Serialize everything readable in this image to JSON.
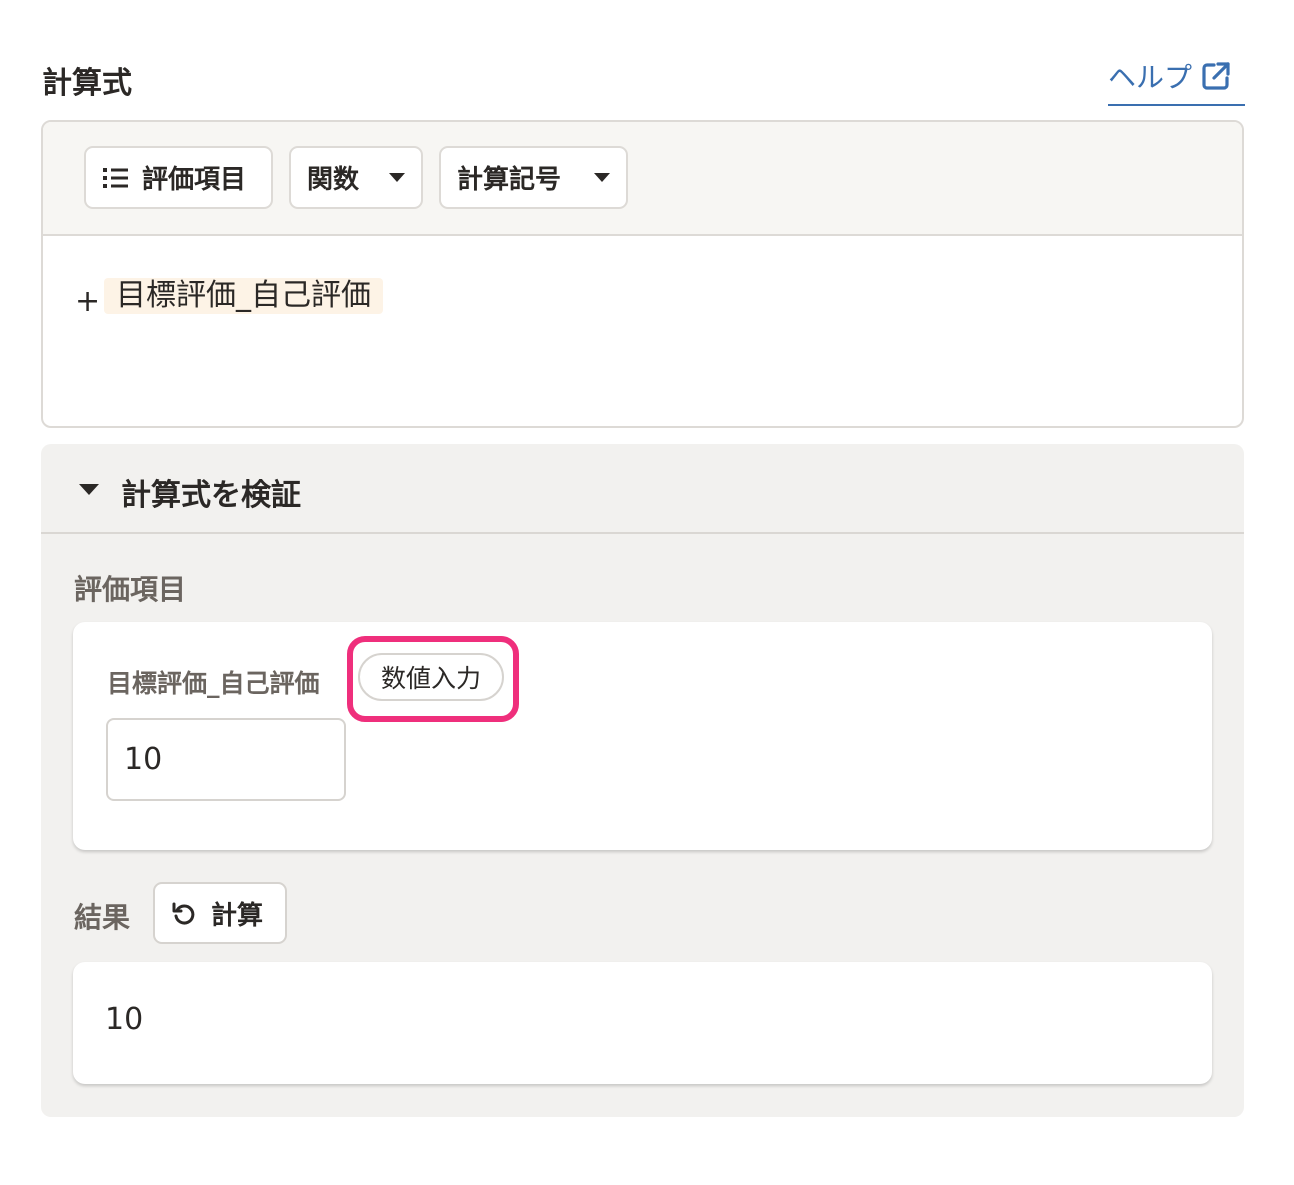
{
  "header": {
    "title": "計算式",
    "help_label": "ヘルプ"
  },
  "toolbar": {
    "items_label": "評価項目",
    "functions_label": "関数",
    "operators_label": "計算記号"
  },
  "formula": {
    "operator": "+",
    "token": "目標評価_自己評価"
  },
  "verify": {
    "title": "計算式を検証",
    "items_section_label": "評価項目",
    "field_label": "目標評価_自己評価",
    "field_type": "数値入力",
    "field_value": "10",
    "result_label": "結果",
    "calc_button_label": "計算",
    "result_value": "10"
  },
  "colors": {
    "link": "#3a6fb0",
    "highlight": "#ef2f7c",
    "token_bg": "#fdf3e6"
  }
}
